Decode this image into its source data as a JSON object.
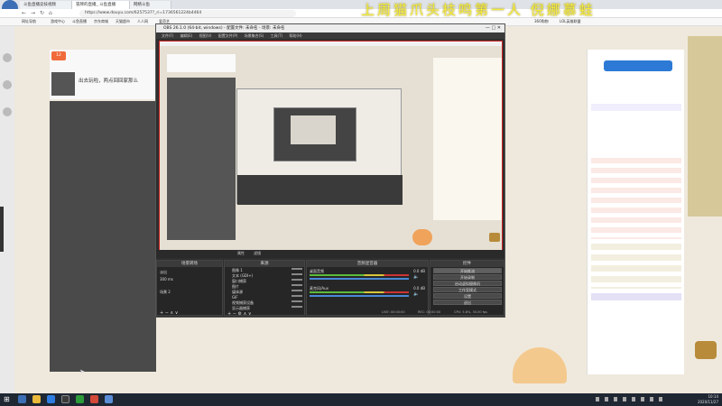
{
  "browser": {
    "tabs": [
      {
        "label": "斗鱼直播竞技视频"
      },
      {
        "label": "冒牌的直播_ 斗鱼直播"
      },
      {
        "label": "网络斗鱼"
      }
    ],
    "url": "https://www.douyu.com/6257537?_ri=1736561224b4464",
    "bookmarks": [
      "网址导航",
      "游戏中心",
      "斗鱼直播",
      "京东商城",
      "天猫超市",
      "人人网",
      "爱奇艺",
      "360购物",
      "LOL英雄联盟"
    ]
  },
  "banner": {
    "text": "上周猫爪头枝鸣第一人 倪娜慕蛙"
  },
  "obs": {
    "title": "OBS 26.1.0 (64-bit, windows) - 配置文件: 未命名 - 场景: 未命名",
    "menu": [
      "文件(F)",
      "编辑(E)",
      "视图(V)",
      "配置文件(P)",
      "场景集合(S)",
      "工具(T)",
      "帮助(H)"
    ],
    "context_bar": [
      "属性",
      "滤镜"
    ],
    "docks": {
      "scenes": {
        "title": "场景转场",
        "items": [
          "场景 2"
        ]
      },
      "sources": {
        "title": "来源",
        "items": [
          "图像 1",
          "文本 (GDI+)",
          "窗口捕获",
          "图片",
          "媒体源",
          "GIF",
          "视频捕获设备",
          "显示器捕获"
        ]
      },
      "mixer": {
        "title": "音频混音器",
        "channels": [
          "桌面音频",
          "麦克风/Aux"
        ],
        "db": [
          "0.0 dB",
          "0.0 dB"
        ]
      },
      "transitions": {
        "title": "场景转场",
        "type": "淡出",
        "duration": "300 ms"
      },
      "controls": {
        "title": "控件",
        "buttons": [
          "开始推流",
          "开始录制",
          "启动虚拟摄像机",
          "工作室模式",
          "设置",
          "退出"
        ]
      }
    },
    "statusbar": {
      "live": "LIVE: 00:00:00",
      "rec": "REC: 00:00:00",
      "cpu": "CPU: 5.8%, 30.00 fps"
    }
  },
  "page": {
    "live_title": "出去玩啦，两点回回家那么",
    "follower_count": "12"
  },
  "taskbar": {
    "time": "10:14",
    "date": "2020/11/27"
  },
  "colors": {
    "accent": "#f3ea3a",
    "obs_bg": "#2f2f2f",
    "preview_border": "#cc2222",
    "taskbar": "#1f2733"
  }
}
